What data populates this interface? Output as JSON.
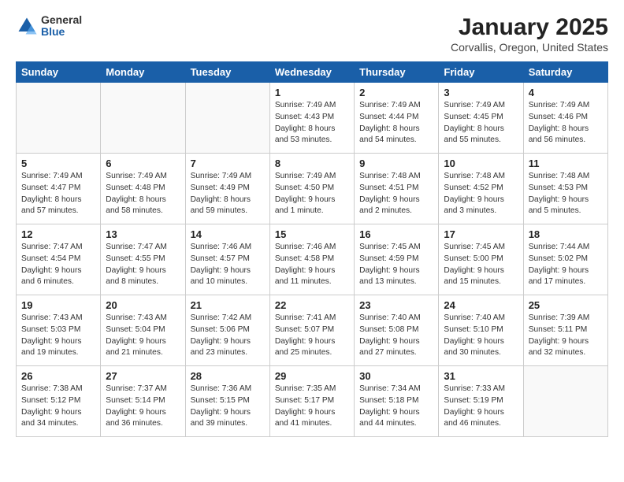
{
  "logo": {
    "general": "General",
    "blue": "Blue"
  },
  "title": "January 2025",
  "subtitle": "Corvallis, Oregon, United States",
  "days_of_week": [
    "Sunday",
    "Monday",
    "Tuesday",
    "Wednesday",
    "Thursday",
    "Friday",
    "Saturday"
  ],
  "weeks": [
    [
      {
        "day": "",
        "info": ""
      },
      {
        "day": "",
        "info": ""
      },
      {
        "day": "",
        "info": ""
      },
      {
        "day": "1",
        "info": "Sunrise: 7:49 AM\nSunset: 4:43 PM\nDaylight: 8 hours and 53 minutes."
      },
      {
        "day": "2",
        "info": "Sunrise: 7:49 AM\nSunset: 4:44 PM\nDaylight: 8 hours and 54 minutes."
      },
      {
        "day": "3",
        "info": "Sunrise: 7:49 AM\nSunset: 4:45 PM\nDaylight: 8 hours and 55 minutes."
      },
      {
        "day": "4",
        "info": "Sunrise: 7:49 AM\nSunset: 4:46 PM\nDaylight: 8 hours and 56 minutes."
      }
    ],
    [
      {
        "day": "5",
        "info": "Sunrise: 7:49 AM\nSunset: 4:47 PM\nDaylight: 8 hours and 57 minutes."
      },
      {
        "day": "6",
        "info": "Sunrise: 7:49 AM\nSunset: 4:48 PM\nDaylight: 8 hours and 58 minutes."
      },
      {
        "day": "7",
        "info": "Sunrise: 7:49 AM\nSunset: 4:49 PM\nDaylight: 8 hours and 59 minutes."
      },
      {
        "day": "8",
        "info": "Sunrise: 7:49 AM\nSunset: 4:50 PM\nDaylight: 9 hours and 1 minute."
      },
      {
        "day": "9",
        "info": "Sunrise: 7:48 AM\nSunset: 4:51 PM\nDaylight: 9 hours and 2 minutes."
      },
      {
        "day": "10",
        "info": "Sunrise: 7:48 AM\nSunset: 4:52 PM\nDaylight: 9 hours and 3 minutes."
      },
      {
        "day": "11",
        "info": "Sunrise: 7:48 AM\nSunset: 4:53 PM\nDaylight: 9 hours and 5 minutes."
      }
    ],
    [
      {
        "day": "12",
        "info": "Sunrise: 7:47 AM\nSunset: 4:54 PM\nDaylight: 9 hours and 6 minutes."
      },
      {
        "day": "13",
        "info": "Sunrise: 7:47 AM\nSunset: 4:55 PM\nDaylight: 9 hours and 8 minutes."
      },
      {
        "day": "14",
        "info": "Sunrise: 7:46 AM\nSunset: 4:57 PM\nDaylight: 9 hours and 10 minutes."
      },
      {
        "day": "15",
        "info": "Sunrise: 7:46 AM\nSunset: 4:58 PM\nDaylight: 9 hours and 11 minutes."
      },
      {
        "day": "16",
        "info": "Sunrise: 7:45 AM\nSunset: 4:59 PM\nDaylight: 9 hours and 13 minutes."
      },
      {
        "day": "17",
        "info": "Sunrise: 7:45 AM\nSunset: 5:00 PM\nDaylight: 9 hours and 15 minutes."
      },
      {
        "day": "18",
        "info": "Sunrise: 7:44 AM\nSunset: 5:02 PM\nDaylight: 9 hours and 17 minutes."
      }
    ],
    [
      {
        "day": "19",
        "info": "Sunrise: 7:43 AM\nSunset: 5:03 PM\nDaylight: 9 hours and 19 minutes."
      },
      {
        "day": "20",
        "info": "Sunrise: 7:43 AM\nSunset: 5:04 PM\nDaylight: 9 hours and 21 minutes."
      },
      {
        "day": "21",
        "info": "Sunrise: 7:42 AM\nSunset: 5:06 PM\nDaylight: 9 hours and 23 minutes."
      },
      {
        "day": "22",
        "info": "Sunrise: 7:41 AM\nSunset: 5:07 PM\nDaylight: 9 hours and 25 minutes."
      },
      {
        "day": "23",
        "info": "Sunrise: 7:40 AM\nSunset: 5:08 PM\nDaylight: 9 hours and 27 minutes."
      },
      {
        "day": "24",
        "info": "Sunrise: 7:40 AM\nSunset: 5:10 PM\nDaylight: 9 hours and 30 minutes."
      },
      {
        "day": "25",
        "info": "Sunrise: 7:39 AM\nSunset: 5:11 PM\nDaylight: 9 hours and 32 minutes."
      }
    ],
    [
      {
        "day": "26",
        "info": "Sunrise: 7:38 AM\nSunset: 5:12 PM\nDaylight: 9 hours and 34 minutes."
      },
      {
        "day": "27",
        "info": "Sunrise: 7:37 AM\nSunset: 5:14 PM\nDaylight: 9 hours and 36 minutes."
      },
      {
        "day": "28",
        "info": "Sunrise: 7:36 AM\nSunset: 5:15 PM\nDaylight: 9 hours and 39 minutes."
      },
      {
        "day": "29",
        "info": "Sunrise: 7:35 AM\nSunset: 5:17 PM\nDaylight: 9 hours and 41 minutes."
      },
      {
        "day": "30",
        "info": "Sunrise: 7:34 AM\nSunset: 5:18 PM\nDaylight: 9 hours and 44 minutes."
      },
      {
        "day": "31",
        "info": "Sunrise: 7:33 AM\nSunset: 5:19 PM\nDaylight: 9 hours and 46 minutes."
      },
      {
        "day": "",
        "info": ""
      }
    ]
  ]
}
